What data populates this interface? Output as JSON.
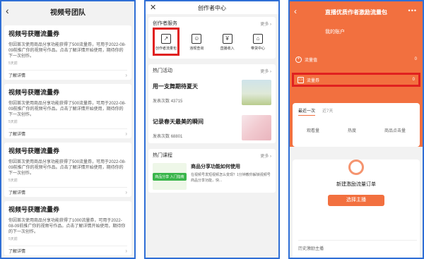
{
  "panel1": {
    "title": "视频号团队",
    "cards": [
      {
        "title": "视频号获赠流量券",
        "body": "你因首次使用商品分享功能获得了500流量券，可用于2022-08-09前推广你的视频号作品。点击了解详情开始使用，期待你的下一次创作。",
        "time": "5天前",
        "link": "了解详情"
      },
      {
        "title": "视频号获赠流量券",
        "body": "你因首次使用商品分享功能获得了500流量券，可用于2022-08-09前推广你的视频号作品。点击了解详情开始使用，期待你的下一次创作。",
        "time": "5天前",
        "link": "了解详情"
      },
      {
        "title": "视频号获赠流量券",
        "body": "你因首次使用商品分享功能获得了500流量券，可用于2022-08-09前推广你的视频号作品。点击了解详情开始使用，期待你的下一次创作。",
        "time": "5天前",
        "link": "了解详情"
      },
      {
        "title": "视频号获赠流量券",
        "body": "你因首次使用商品分享功能获得了1000流量券，可用于2022-08-09前推广你的视频号作品。点击了解详情开始使用，期待你的下一次创作。",
        "time": "5天前",
        "link": "了解详情"
      }
    ]
  },
  "panel2": {
    "title": "创作者中心",
    "services_title": "创作者服务",
    "more": "更多",
    "services": [
      {
        "label": "创作者流量包",
        "icon": "chart-icon"
      },
      {
        "label": "违规查询",
        "icon": "user-icon"
      },
      {
        "label": "直播收入",
        "icon": "money-icon"
      },
      {
        "label": "带货中心",
        "icon": "store-icon"
      }
    ],
    "activities_title": "热门活动",
    "activities": [
      {
        "title": "用一支舞期待夏天",
        "stat_label": "发表次数",
        "stat_value": "43715"
      },
      {
        "title": "记录春天最美的瞬间",
        "stat_label": "发表次数",
        "stat_value": "68801"
      }
    ],
    "courses_title": "热门课程",
    "course": {
      "image_text": "商品分享 入门指南",
      "title": "商品分享功能如何使用",
      "desc": "在视频号发短视频怎么变现？1分钟教你解锁视频号商品分享功能，快..."
    }
  },
  "panel3": {
    "title": "直播优质作者激励流量包",
    "account": "我的账户",
    "rows": [
      {
        "label": "流量值",
        "value": "0"
      },
      {
        "label": "流量券",
        "value": "0"
      }
    ],
    "tabs": [
      "最近一次",
      "近7天"
    ],
    "metrics": [
      "观看量",
      "热度",
      "商品点击量"
    ],
    "new_order": "新建激励流量订单",
    "select_button": "选择主播",
    "history": "历史激励主播"
  },
  "colors": {
    "accent": "#f2703f",
    "highlight": "#e02020",
    "frame": "#2f6fd6"
  }
}
